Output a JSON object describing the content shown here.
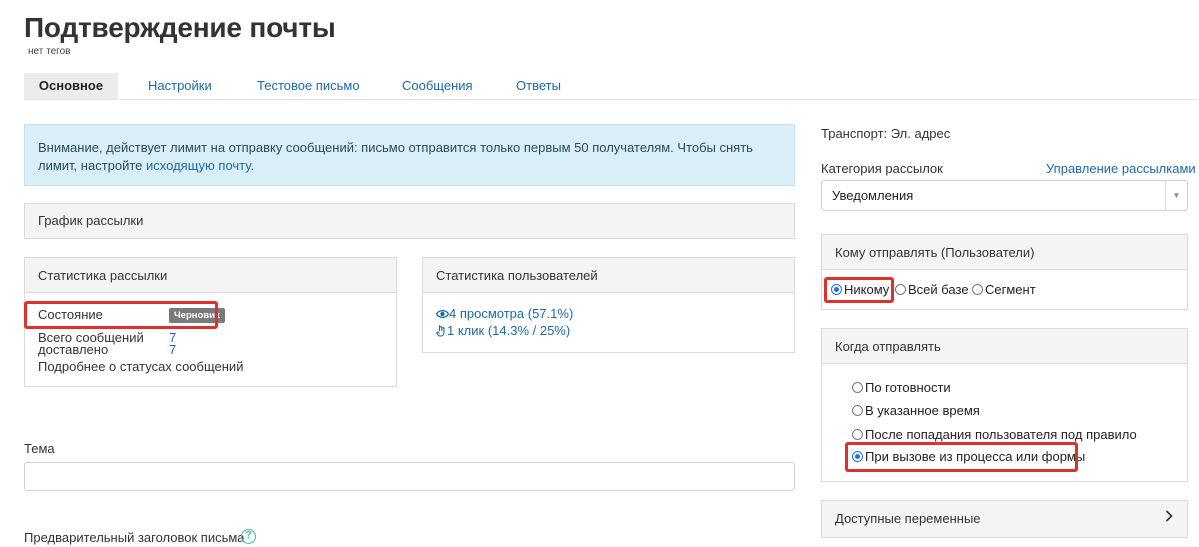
{
  "page": {
    "title": "Подтверждение почты",
    "tags": "нет тегов"
  },
  "tabs": [
    "Основное",
    "Настройки",
    "Тестовое письмо",
    "Сообщения",
    "Ответы"
  ],
  "alert": {
    "text_before_link": "Внимание, действует лимит на отправку сообщений: письмо отправится только первым 50 получателям. Чтобы снять лимит, настройте ",
    "link": "исходящую почту",
    "text_after_link": "."
  },
  "schedule": {
    "title": "График рассылки"
  },
  "mailing_stats": {
    "title": "Статистика рассылки",
    "status_label": "Состояние",
    "status_badge": "Черновик",
    "total_label": "Всего сообщений",
    "total_value": "7",
    "delivered_label": "доставлено",
    "delivered_value": "7",
    "details_link": "Подробнее о статусах сообщений"
  },
  "user_stats": {
    "title": "Статистика пользователей",
    "views": "4 просмотра (57.1%)",
    "clicks": "1 клик (14.3% / 25%)"
  },
  "subject": {
    "label": "Тема",
    "value": ""
  },
  "preheader": {
    "label": "Предварительный заголовок письма",
    "help": "?"
  },
  "right": {
    "transport": "Транспорт: Эл. адрес",
    "category_label": "Категория рассылок",
    "manage_link": "Управление рассылками",
    "category_value": "Уведомления"
  },
  "recipients": {
    "title": "Кому отправлять (Пользователи)",
    "options": [
      "Никому",
      "Всей базе",
      "Сегмент"
    ],
    "selected": "Никому"
  },
  "when": {
    "title": "Когда отправлять",
    "options": [
      "По готовности",
      "В указанное время",
      "После попадания пользователя под правило",
      "При вызове из процесса или формы"
    ],
    "selected": "При вызове из процесса или формы"
  },
  "variables": {
    "title": "Доступные переменные"
  },
  "colors": {
    "link": "#1a6aa8",
    "highlight": "#e0302d",
    "alert_bg": "#d9eef7",
    "radio_checked": "#1a73e8"
  }
}
